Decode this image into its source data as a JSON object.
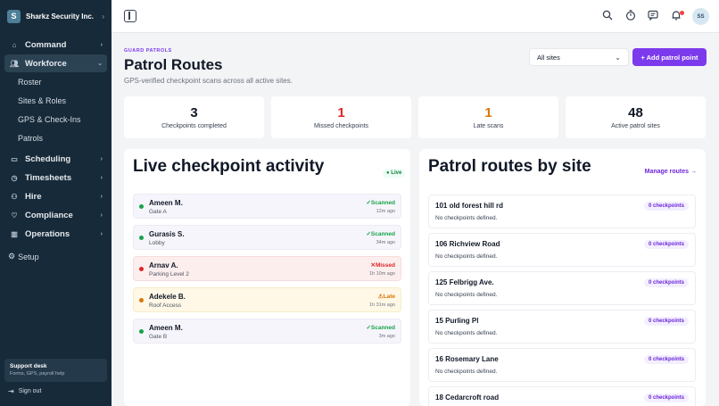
{
  "app": {
    "brand_initial": "S",
    "brand_name": "Sharkz Security Inc.",
    "user_initials": "SS"
  },
  "sidebar": {
    "nav": [
      {
        "label": "Command",
        "icon": "home-icon"
      },
      {
        "label": "Workforce",
        "icon": "users-icon",
        "active": true
      },
      {
        "label": "Scheduling",
        "icon": "calendar-icon"
      },
      {
        "label": "Timesheets",
        "icon": "clock-icon"
      },
      {
        "label": "Hire",
        "icon": "user-plus-icon"
      },
      {
        "label": "Compliance",
        "icon": "heart-icon"
      },
      {
        "label": "Operations",
        "icon": "chart-icon"
      }
    ],
    "workforce_sub": [
      "Roster",
      "Sites & Roles",
      "GPS & Check-Ins",
      "Patrols"
    ],
    "setup_label": "Setup",
    "support_title": "Support desk",
    "support_sub": "Forms, GPS, payroll help",
    "signout_label": "Sign out"
  },
  "header": {
    "eyebrow": "GUARD PATROLS",
    "title": "Patrol Routes",
    "subtitle": "GPS-verified checkpoint scans across all active sites.",
    "site_filter": "All sites",
    "add_button": "+ Add patrol point"
  },
  "stats": [
    {
      "value": "3",
      "label": "Checkpoints completed",
      "color": "#111827"
    },
    {
      "value": "1",
      "label": "Missed checkpoints",
      "color": "#dc2626"
    },
    {
      "value": "1",
      "label": "Late scans",
      "color": "#d97706"
    },
    {
      "value": "48",
      "label": "Active patrol sites",
      "color": "#111827"
    }
  ],
  "activity": {
    "title": "Live checkpoint activity",
    "badge": "● Live",
    "items": [
      {
        "name": "Ameen M.",
        "point": "Gate A",
        "status": "✓Scanned",
        "time": "12m ago",
        "kind": "scanned"
      },
      {
        "name": "Gurasis S.",
        "point": "Lobby",
        "status": "✓Scanned",
        "time": "34m ago",
        "kind": "scanned"
      },
      {
        "name": "Arnav A.",
        "point": "Parking Level 2",
        "status": "✕Missed",
        "time": "1h 10m ago",
        "kind": "missed"
      },
      {
        "name": "Adekele B.",
        "point": "Roof Access",
        "status": "⚠Late",
        "time": "1h 31m ago",
        "kind": "late"
      },
      {
        "name": "Ameen M.",
        "point": "Gate B",
        "status": "✓Scanned",
        "time": "3m ago",
        "kind": "scanned"
      }
    ]
  },
  "routes": {
    "title": "Patrol routes by site",
    "manage_link": "Manage routes →",
    "items": [
      {
        "name": "101 old forest hill rd",
        "desc": "No checkpoints defined.",
        "badge": "0 checkpoints"
      },
      {
        "name": "106 Richview Road",
        "desc": "No checkpoints defined.",
        "badge": "0 checkpoints"
      },
      {
        "name": "125 Felbrigg Ave.",
        "desc": "No checkpoints defined.",
        "badge": "0 checkpoints"
      },
      {
        "name": "15 Purling Pl",
        "desc": "No checkpoints defined.",
        "badge": "0 checkpoints"
      },
      {
        "name": "16 Rosemary Lane",
        "desc": "No checkpoints defined.",
        "badge": "0 checkpoints"
      },
      {
        "name": "18 Cedarcroft road",
        "desc": "",
        "badge": "0 checkpoints"
      }
    ]
  },
  "colors": {
    "accent": "#7c3aed",
    "scanned": "#16a34a",
    "missed": "#dc2626",
    "late": "#d97706"
  }
}
